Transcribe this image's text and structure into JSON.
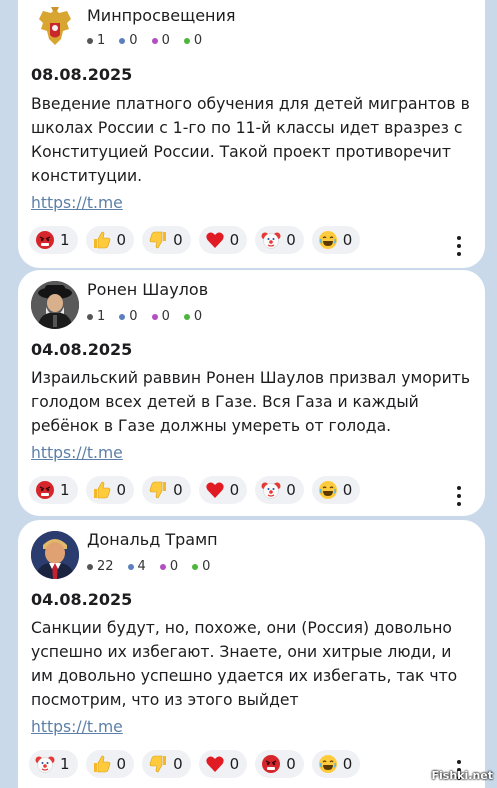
{
  "posts": [
    {
      "author": "Минпросвещения",
      "stats": [
        "1",
        "0",
        "0",
        "0"
      ],
      "date": "08.08.2025",
      "text": "Введение платного обучения для детей мигрантов в школах России с 1-го по 11-й классы идет вразрез с Конституцией России. Такой проект противоречит конституции.",
      "link": "https://t.me",
      "reactions": [
        {
          "icon": "angry-face-icon",
          "count": "1"
        },
        {
          "icon": "thumbs-up-icon",
          "count": "0"
        },
        {
          "icon": "thumbs-down-icon",
          "count": "0"
        },
        {
          "icon": "heart-icon",
          "count": "0"
        },
        {
          "icon": "clown-face-icon",
          "count": "0"
        },
        {
          "icon": "laughing-face-icon",
          "count": "0"
        }
      ]
    },
    {
      "author": "Ронен Шаулов",
      "stats": [
        "1",
        "0",
        "0",
        "0"
      ],
      "date": "04.08.2025",
      "text": "Израильский раввин Ронен Шаулов призвал уморить голодом всех детей в Газе. Вся Газа и каждый ребёнок в Газе должны умереть от голода.",
      "link": "https://t.me",
      "reactions": [
        {
          "icon": "angry-face-icon",
          "count": "1"
        },
        {
          "icon": "thumbs-up-icon",
          "count": "0"
        },
        {
          "icon": "thumbs-down-icon",
          "count": "0"
        },
        {
          "icon": "heart-icon",
          "count": "0"
        },
        {
          "icon": "clown-face-icon",
          "count": "0"
        },
        {
          "icon": "laughing-face-icon",
          "count": "0"
        }
      ]
    },
    {
      "author": "Дональд Трамп",
      "stats": [
        "22",
        "4",
        "0",
        "0"
      ],
      "date": "04.08.2025",
      "text": "Санкции будут, но, похоже, они (Россия) довольно успешно их избегают. Знаете, они хитрые люди, и им довольно успешно удается их избегать, так что посмотрим, что из этого выйдет",
      "link": "https://t.me",
      "reactions": [
        {
          "icon": "clown-face-icon",
          "count": "1"
        },
        {
          "icon": "thumbs-up-icon",
          "count": "0"
        },
        {
          "icon": "thumbs-down-icon",
          "count": "0"
        },
        {
          "icon": "heart-icon",
          "count": "0"
        },
        {
          "icon": "angry-face-icon",
          "count": "0"
        },
        {
          "icon": "laughing-face-icon",
          "count": "0"
        }
      ]
    }
  ],
  "stat_colors": [
    "#555555",
    "#5b7fbf",
    "#b24fc0",
    "#4cb53a"
  ],
  "watermark": "Fishki.net"
}
